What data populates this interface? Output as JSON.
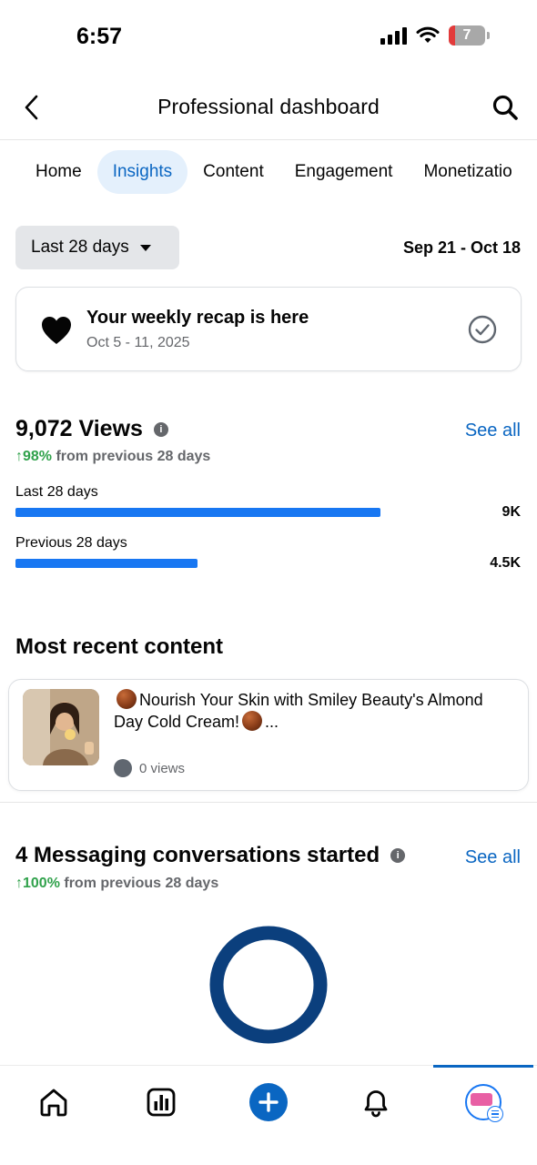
{
  "status_bar": {
    "time": "6:57",
    "battery_level": "7"
  },
  "header": {
    "title": "Professional dashboard"
  },
  "tabs": [
    {
      "label": "Home",
      "active": false
    },
    {
      "label": "Insights",
      "active": true
    },
    {
      "label": "Content",
      "active": false
    },
    {
      "label": "Engagement",
      "active": false
    },
    {
      "label": "Monetizatio",
      "active": false
    }
  ],
  "filter": {
    "range_label": "Last 28 days",
    "date_range": "Sep 21 - Oct 18"
  },
  "recap": {
    "title": "Your weekly recap is here",
    "dates": "Oct 5 - 11, 2025"
  },
  "views": {
    "title": "9,072 Views",
    "info": "i",
    "see_all": "See all",
    "delta_arrow_pct": "↑98%",
    "delta_text": " from previous 28 days",
    "bars": [
      {
        "label": "Last 28 days",
        "value_label": "9K",
        "value": 9000
      },
      {
        "label": "Previous 28 days",
        "value_label": "4.5K",
        "value": 4500
      }
    ],
    "bar_max": 11450
  },
  "recent": {
    "title": "Most recent content",
    "post_text_1": "Nourish Your Skin with Smiley Beauty's Almond Day Cold Cream!",
    "post_text_2": "...",
    "views_label": "0 views"
  },
  "messaging": {
    "title": "4 Messaging conversations started",
    "info": "i",
    "see_all": "See all",
    "delta_arrow_pct": "↑100%",
    "delta_text": " from previous 28 days",
    "ring_color": "#0b3f7d"
  },
  "bottom_nav": {
    "items": [
      "home-icon",
      "insights-icon",
      "create-plus-icon",
      "notifications-bell-icon",
      "profile-avatar"
    ],
    "active": "profile-avatar"
  },
  "colors": {
    "accent": "#0a66c2",
    "bar": "#1877f2",
    "positive": "#31a24c"
  }
}
